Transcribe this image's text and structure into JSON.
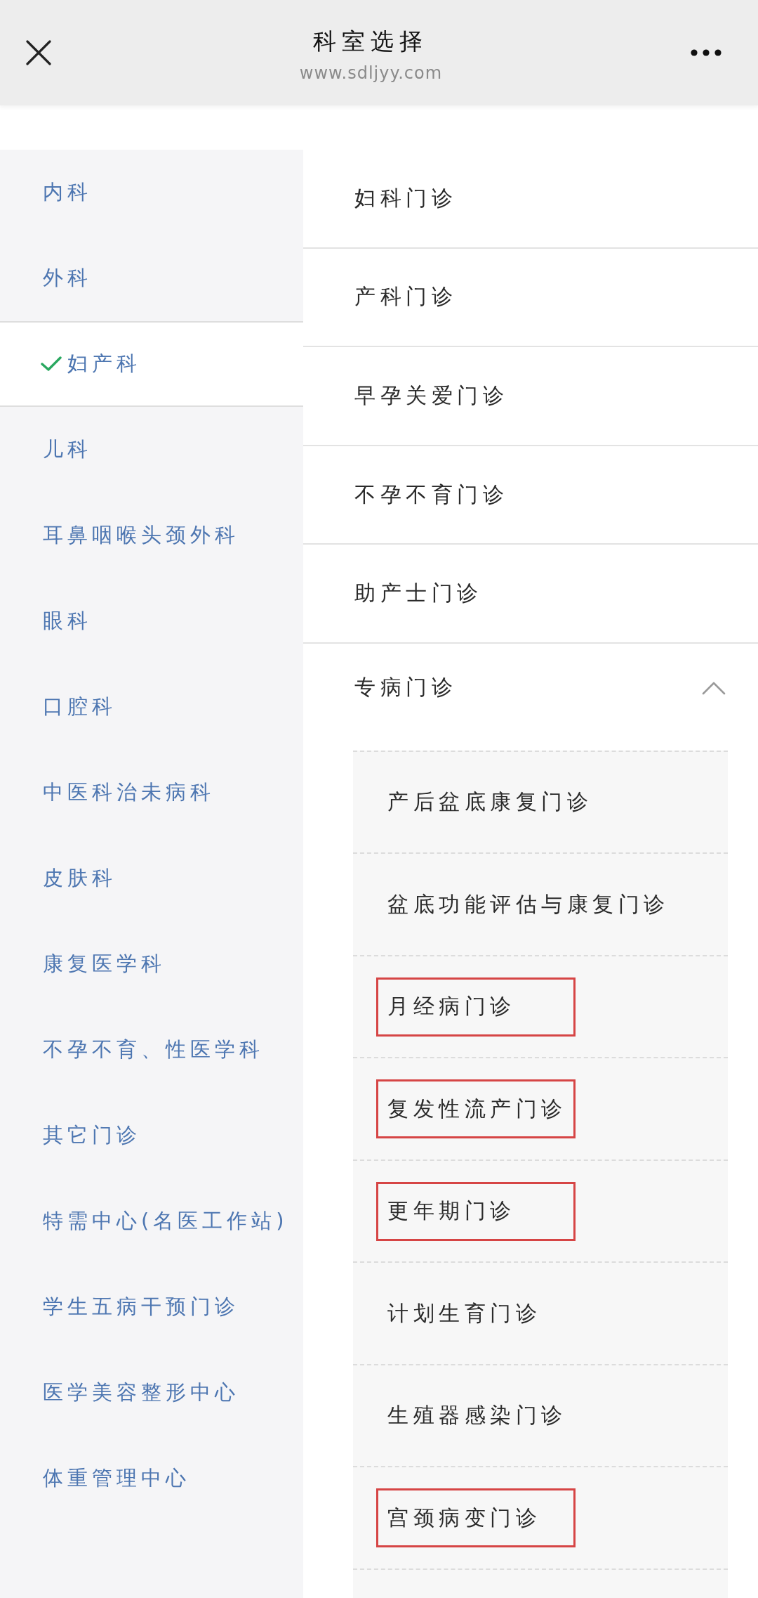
{
  "header": {
    "title": "科室选择",
    "subtitle": "www.sdljyy.com"
  },
  "departments": [
    {
      "name": "内科",
      "selected": false
    },
    {
      "name": "外科",
      "selected": false
    },
    {
      "name": "妇产科",
      "selected": true
    },
    {
      "name": "儿科",
      "selected": false
    },
    {
      "name": "耳鼻咽喉头颈外科",
      "selected": false
    },
    {
      "name": "眼科",
      "selected": false
    },
    {
      "name": "口腔科",
      "selected": false
    },
    {
      "name": "中医科治未病科",
      "selected": false
    },
    {
      "name": "皮肤科",
      "selected": false
    },
    {
      "name": "康复医学科",
      "selected": false
    },
    {
      "name": "不孕不育、性医学科",
      "selected": false
    },
    {
      "name": "其它门诊",
      "selected": false
    },
    {
      "name": "特需中心(名医工作站)",
      "selected": false
    },
    {
      "name": "学生五病干预门诊",
      "selected": false
    },
    {
      "name": "医学美容整形中心",
      "selected": false
    },
    {
      "name": "体重管理中心",
      "selected": false
    }
  ],
  "clinics": [
    {
      "kind": "link",
      "name": "妇科门诊"
    },
    {
      "kind": "link",
      "name": "产科门诊"
    },
    {
      "kind": "link",
      "name": "早孕关爱门诊"
    },
    {
      "kind": "link",
      "name": "不孕不育门诊"
    },
    {
      "kind": "link",
      "name": "助产士门诊"
    },
    {
      "kind": "group",
      "name": "专病门诊",
      "expanded": true,
      "children": [
        {
          "name": "产后盆底康复门诊",
          "highlighted": false
        },
        {
          "name": "盆底功能评估与康复门诊",
          "highlighted": false
        },
        {
          "name": "月经病门诊",
          "highlighted": true
        },
        {
          "name": "复发性流产门诊",
          "highlighted": true
        },
        {
          "name": "更年期门诊",
          "highlighted": true
        },
        {
          "name": "计划生育门诊",
          "highlighted": false
        },
        {
          "name": "生殖器感染门诊",
          "highlighted": false
        },
        {
          "name": "宫颈病变门诊",
          "highlighted": true
        }
      ]
    }
  ]
}
